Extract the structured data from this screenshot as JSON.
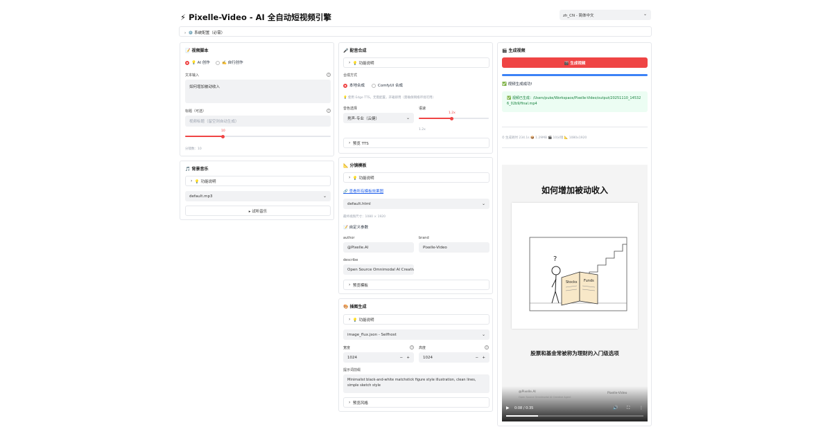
{
  "header": {
    "title": "⚡ Pixelle-Video - AI 全自动短视频引擎",
    "language": "zh_CN - 简体中文",
    "system_config": "⚙️ 系统配置（必需）"
  },
  "script_panel": {
    "title": "📝 视频脚本",
    "mode_ai": "💡 AI 创作",
    "mode_custom": "✍️ 自行创作",
    "text_label": "文本输入",
    "text_value": "如何增加被动收入",
    "title_label": "标题（可选）",
    "title_placeholder": "视频标题（留空则自动生成）",
    "slider_value": "10",
    "scenes_label": "分镜数：10"
  },
  "music_panel": {
    "title": "🎵 背景音乐",
    "help": "💡 功能说明",
    "select": "default.mp3",
    "preview_btn": "▸ 试听音乐"
  },
  "voice_panel": {
    "title": "🎤 配音合成",
    "help": "💡 功能说明",
    "method_label": "合成方式",
    "opt_local": "本地合成",
    "opt_comfy": "ComfyUI 合成",
    "note": "💡 使用 Edge TTS，无需配置，开箱即用（需确保网络环境可用）",
    "voice_label": "音色选择",
    "voice_value": "男声-专业（云健）",
    "speed_label": "语速",
    "speed_value": "1.2x",
    "speed_max": "1.2x",
    "preview": "预览 TTS"
  },
  "storyboard_panel": {
    "title": "📐 分镜模板",
    "help": "💡 功能说明",
    "link": "🔗 查看所有模板效果图",
    "select": "default.html",
    "size_note": "最终视频尺寸：1080 × 1920",
    "custom_title": "📝 自定义参数",
    "author_label": "author",
    "author_value": "@Pixelle.AI",
    "brand_label": "brand",
    "brand_value": "Pixelle-Video",
    "describe_label": "describe",
    "describe_value": "Open Source Omnimodal AI Creative",
    "preview": "预览模板"
  },
  "image_panel": {
    "title": "🎨 插图生成",
    "help": "💡 功能说明",
    "workflow": "image_flux.json - Selfhost",
    "width_label": "宽度",
    "width_value": "1024",
    "height_label": "高度",
    "height_value": "1024",
    "prompt_label": "提示词前缀",
    "prompt_value": "Minimalist black-and-white matchstick figure style illustration, clean lines, simple sketch style",
    "preview": "预览风格"
  },
  "output_panel": {
    "title": "🎬 生成视频",
    "generate_btn": "🎬 生成视频",
    "progress": 1.0,
    "success": "✅ 视频生成成功!",
    "path_msg": "✅ 视频已生成：/Users/puke/Workspace/Pixelle-Video/output/20251110_145326_02b9/final.mp4",
    "stats": "⏱ 生成耗时 234.1s 📦 1.29MB 🎬 10分镜 📐 1080x1920"
  },
  "video": {
    "headline": "如何增加被动收入",
    "caption": "股票和基金常被称为理财的入门级选项",
    "author": "@Pixelle.AI",
    "brand": "Pixelle-Video",
    "describe": "Open Source Omnimodal AI Creative Agent",
    "time": "0:08 / 0:35",
    "progress": 0.23,
    "book_left": "Stocks",
    "book_right": "Funds"
  },
  "colors": {
    "accent": "#ef4444",
    "success_bg": "#ecfdf3",
    "success_text": "#15803d",
    "progress": "#3b82f6"
  }
}
